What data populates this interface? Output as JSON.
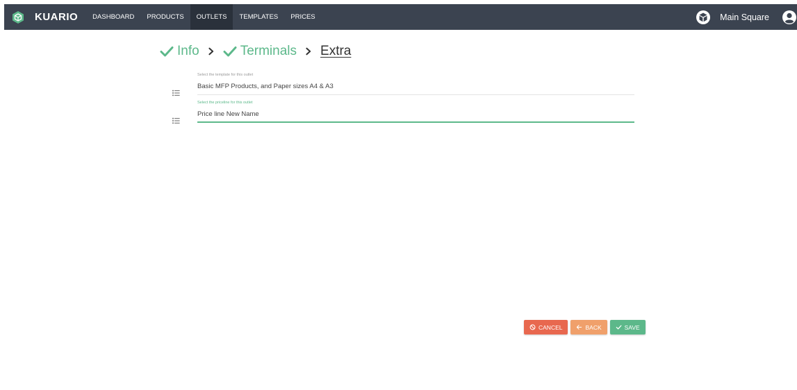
{
  "app": {
    "brand": "KUARIO",
    "nav": [
      {
        "label": "DASHBOARD",
        "active": false
      },
      {
        "label": "PRODUCTS",
        "active": false
      },
      {
        "label": "OUTLETS",
        "active": true
      },
      {
        "label": "TEMPLATES",
        "active": false
      },
      {
        "label": "PRICES",
        "active": false
      }
    ],
    "store_name": "Main Square",
    "colors": {
      "navbar": "#3b4350",
      "accent": "#5cb88a",
      "cancel": "#e8684f",
      "back": "#f0a06b"
    }
  },
  "stepper": {
    "steps": [
      {
        "label": "Info",
        "status": "done"
      },
      {
        "label": "Terminals",
        "status": "done"
      },
      {
        "label": "Extra",
        "status": "current"
      }
    ]
  },
  "form": {
    "template": {
      "label": "Select the template for this outlet",
      "value": "Basic MFP Products, and Paper sizes A4 & A3",
      "icon": "list-icon"
    },
    "priceline": {
      "label": "Select the priceline for this outlet",
      "value": "Price line New Name",
      "icon": "list-icon"
    }
  },
  "actions": {
    "cancel": "CANCEL",
    "back": "BACK",
    "save": "SAVE"
  }
}
